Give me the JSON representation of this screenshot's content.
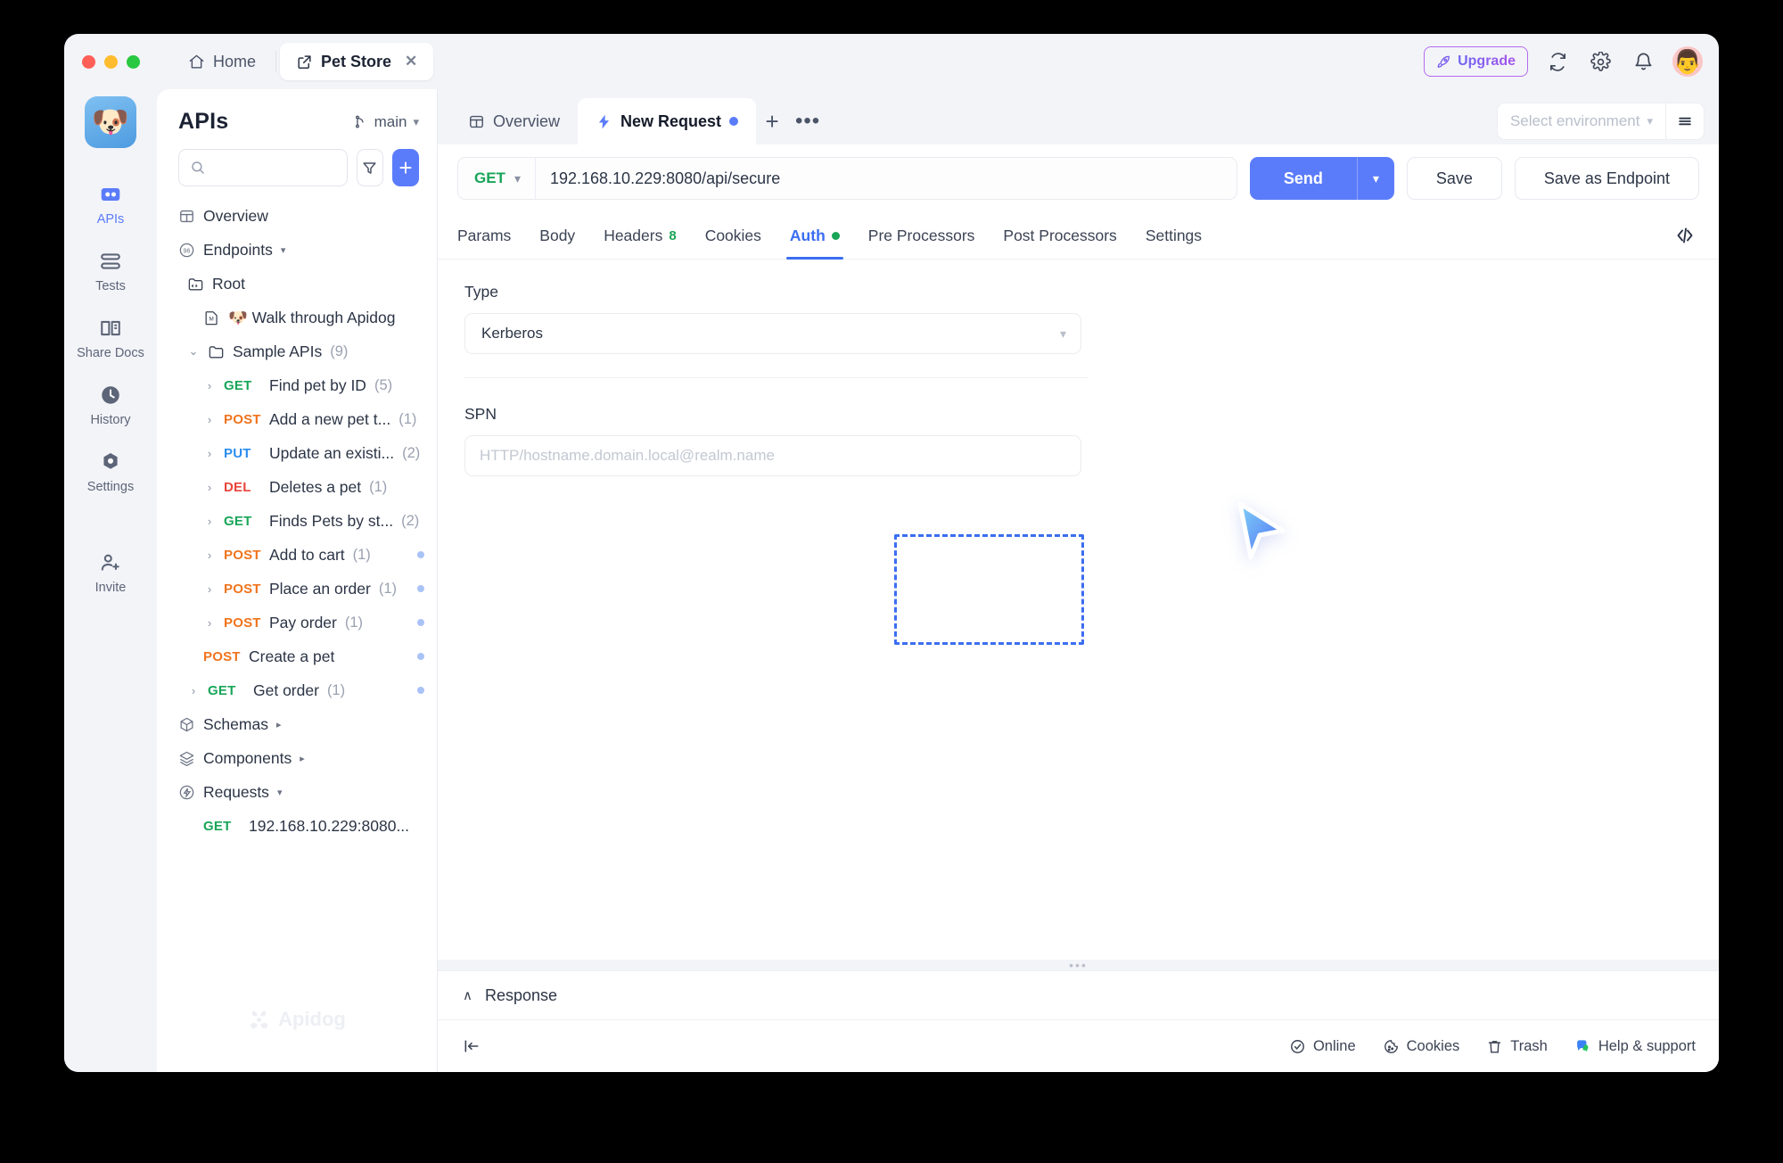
{
  "window": {
    "home_tab": "Home",
    "project_tab": "Pet Store",
    "upgrade_label": "Upgrade",
    "icons": {
      "home": "home-icon",
      "external": "external-link-icon",
      "close": "close-icon",
      "rocket": "rocket-icon",
      "sync": "sync-icon",
      "gear": "gear-icon",
      "bell": "bell-icon",
      "avatar": "avatar"
    }
  },
  "rail": {
    "logo": "project-logo",
    "items": [
      {
        "label": "APIs",
        "icon": "apis-icon",
        "active": true
      },
      {
        "label": "Tests",
        "icon": "tests-icon",
        "active": false
      },
      {
        "label": "Share Docs",
        "icon": "share-docs-icon",
        "active": false
      },
      {
        "label": "History",
        "icon": "history-icon",
        "active": false
      },
      {
        "label": "Settings",
        "icon": "settings-icon",
        "active": false
      },
      {
        "label": "Invite",
        "icon": "invite-icon",
        "active": false
      }
    ]
  },
  "tree": {
    "title": "APIs",
    "branch": "main",
    "search_placeholder": "",
    "search_value": "",
    "filter_icon": "filter-icon",
    "add_label": "+",
    "watermark": "Apidog",
    "rows": [
      {
        "id": "overview",
        "indent": 0,
        "icon": "overview-icon",
        "label": "Overview"
      },
      {
        "id": "endpoints",
        "indent": 0,
        "icon": "endpoints-icon",
        "label": "Endpoints",
        "tri": "▾"
      },
      {
        "id": "root",
        "indent": 1,
        "icon": "folder-code-icon",
        "label": "Root"
      },
      {
        "id": "walk",
        "indent": 2,
        "icon": "markdown-icon",
        "label": "🐶 Walk through Apidog"
      },
      {
        "id": "sample-apis",
        "indent": 1,
        "caret": "⌄",
        "icon": "folder-icon",
        "label": "Sample APIs",
        "count": "(9)"
      },
      {
        "id": "find-pet",
        "indent": 2,
        "caret": "›",
        "method": "GET",
        "label": "Find pet by ID",
        "count": "(5)"
      },
      {
        "id": "add-new-pet",
        "indent": 2,
        "caret": "›",
        "method": "POST",
        "label": "Add a new pet t...",
        "count": "(1)"
      },
      {
        "id": "update-existing",
        "indent": 2,
        "caret": "›",
        "method": "PUT",
        "label": "Update an existi...",
        "count": "(2)"
      },
      {
        "id": "deletes-a-pet",
        "indent": 2,
        "caret": "›",
        "method": "DEL",
        "label": "Deletes a pet",
        "count": "(1)"
      },
      {
        "id": "finds-pets-status",
        "indent": 2,
        "caret": "›",
        "method": "GET",
        "label": "Finds Pets by st...",
        "count": "(2)"
      },
      {
        "id": "add-to-cart",
        "indent": 2,
        "caret": "›",
        "method": "POST",
        "label": "Add to cart",
        "count": "(1)",
        "dot": true
      },
      {
        "id": "place-an-order",
        "indent": 2,
        "caret": "›",
        "method": "POST",
        "label": "Place an order",
        "count": "(1)",
        "dot": true
      },
      {
        "id": "pay-order",
        "indent": 2,
        "caret": "›",
        "method": "POST",
        "label": "Pay order",
        "count": "(1)",
        "dot": true
      },
      {
        "id": "create-a-pet",
        "indent": 2,
        "method": "POST",
        "label": "Create a pet",
        "dot": true
      },
      {
        "id": "get-order",
        "indent": 1,
        "caret": "›",
        "method": "GET",
        "label": "Get order",
        "count": "(1)",
        "dot": true
      },
      {
        "id": "schemas",
        "indent": 0,
        "icon": "schemas-icon",
        "label": "Schemas",
        "tri": "▸"
      },
      {
        "id": "components",
        "indent": 0,
        "icon": "components-icon",
        "label": "Components",
        "tri": "▸"
      },
      {
        "id": "requests",
        "indent": 0,
        "icon": "requests-icon",
        "label": "Requests",
        "tri": "▾"
      },
      {
        "id": "saved-request",
        "indent": 2,
        "method": "GET",
        "label": "192.168.10.229:8080..."
      }
    ]
  },
  "main": {
    "tabs": [
      {
        "label": "Overview",
        "icon": "overview-icon",
        "active": false,
        "unsaved": false
      },
      {
        "label": "New Request",
        "icon": "lightning-icon",
        "active": true,
        "unsaved": true
      }
    ],
    "new_tab_label": "+",
    "more_tabs_label": "•••",
    "environment": {
      "placeholder": "Select environment",
      "value": "",
      "menu_icon": "env-menu-icon"
    },
    "request": {
      "method": "GET",
      "url": "192.168.10.229:8080/api/secure",
      "send_label": "Send",
      "save_label": "Save",
      "save_endpoint_label": "Save as Endpoint"
    },
    "req_tabs": [
      {
        "label": "Params",
        "active": false
      },
      {
        "label": "Body",
        "active": false
      },
      {
        "label": "Headers",
        "count": "8",
        "active": false
      },
      {
        "label": "Cookies",
        "active": false
      },
      {
        "label": "Auth",
        "dot": true,
        "active": true
      },
      {
        "label": "Pre Processors",
        "active": false
      },
      {
        "label": "Post Processors",
        "active": false
      },
      {
        "label": "Settings",
        "active": false
      }
    ],
    "code_icon": "code-icon",
    "auth": {
      "type_label": "Type",
      "type_value": "Kerberos",
      "spn_label": "SPN",
      "spn_value": "",
      "spn_placeholder": "HTTP/hostname.domain.local@realm.name"
    },
    "response": {
      "label": "Response",
      "collapsed_caret": "∧"
    },
    "statusbar": {
      "collapse_icon": "collapse-panel-icon",
      "items": [
        {
          "label": "Online",
          "icon": "online-icon"
        },
        {
          "label": "Cookies",
          "icon": "cookie-icon"
        },
        {
          "label": "Trash",
          "icon": "trash-icon"
        },
        {
          "label": "Help & support",
          "icon": "help-icon"
        }
      ]
    }
  },
  "colors": {
    "accent": "#5b7cfa",
    "get": "#18a558",
    "post": "#f0741d",
    "put": "#2b8ef0",
    "del": "#e8453c",
    "highlight": "#3b6ef0"
  }
}
